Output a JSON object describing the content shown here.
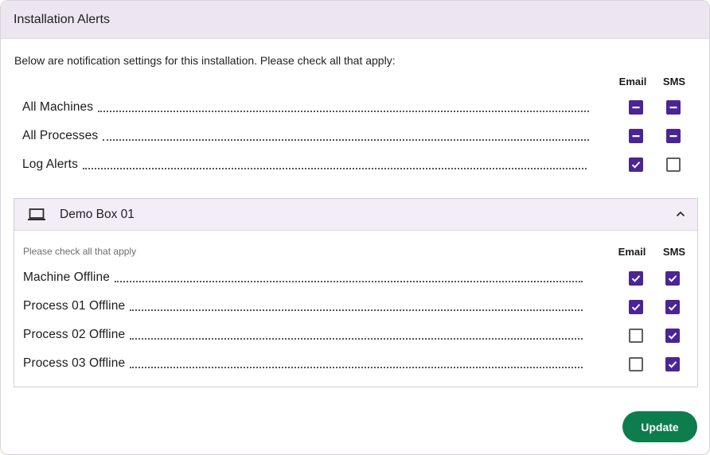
{
  "card": {
    "title": "Installation Alerts",
    "intro": "Below are notification settings for this installation. Please check all that apply:",
    "columns": {
      "email": "Email",
      "sms": "SMS"
    },
    "rows": [
      {
        "label": "All Machines",
        "email": "indeterminate",
        "sms": "indeterminate"
      },
      {
        "label": "All Processes",
        "email": "indeterminate",
        "sms": "indeterminate"
      },
      {
        "label": "Log Alerts",
        "email": "checked",
        "sms": "unchecked"
      }
    ]
  },
  "machine": {
    "icon": "laptop-icon",
    "name": "Demo Box 01",
    "expanded": true,
    "chevron_icon": "chevron-up-icon",
    "hint": "Please check all that apply",
    "columns": {
      "email": "Email",
      "sms": "SMS"
    },
    "rows": [
      {
        "label": "Machine Offline",
        "email": "checked",
        "sms": "checked"
      },
      {
        "label": "Process 01 Offline",
        "email": "checked",
        "sms": "checked"
      },
      {
        "label": "Process 02 Offline",
        "email": "unchecked",
        "sms": "checked"
      },
      {
        "label": "Process 03 Offline",
        "email": "unchecked",
        "sms": "checked"
      }
    ]
  },
  "update_label": "Update",
  "colors": {
    "accent": "#4b2593",
    "header_bg": "#ede6f1",
    "button": "#0d7d4d"
  }
}
